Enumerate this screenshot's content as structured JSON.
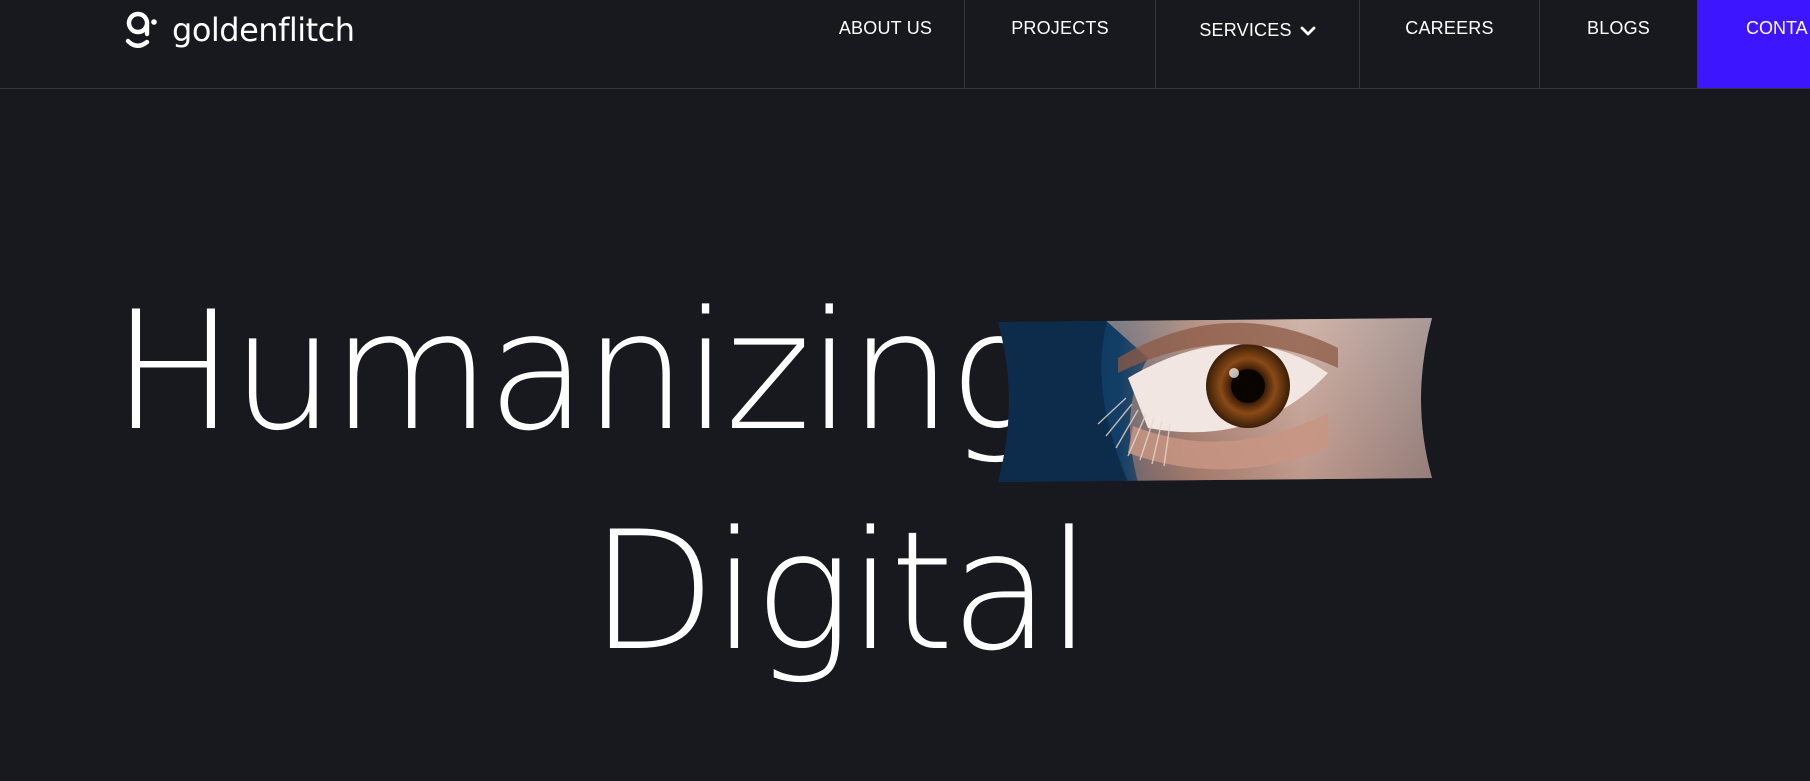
{
  "brand": {
    "name": "goldenflitch",
    "icon": "goldenflitch-logo-icon"
  },
  "nav": {
    "items": [
      {
        "label": "ABOUT US"
      },
      {
        "label": "PROJECTS"
      },
      {
        "label": "SERVICES",
        "icon": "chevron-down-icon"
      },
      {
        "label": "CAREERS"
      },
      {
        "label": "BLOGS"
      }
    ],
    "contact_label": "CONTA"
  },
  "hero": {
    "line1": "Humanizing",
    "line2": "Digital",
    "image": "eye-closeup-photo"
  },
  "colors": {
    "background": "#18191e",
    "accent": "#3d16ff",
    "text": "#ffffff",
    "divider": "#34363d"
  }
}
